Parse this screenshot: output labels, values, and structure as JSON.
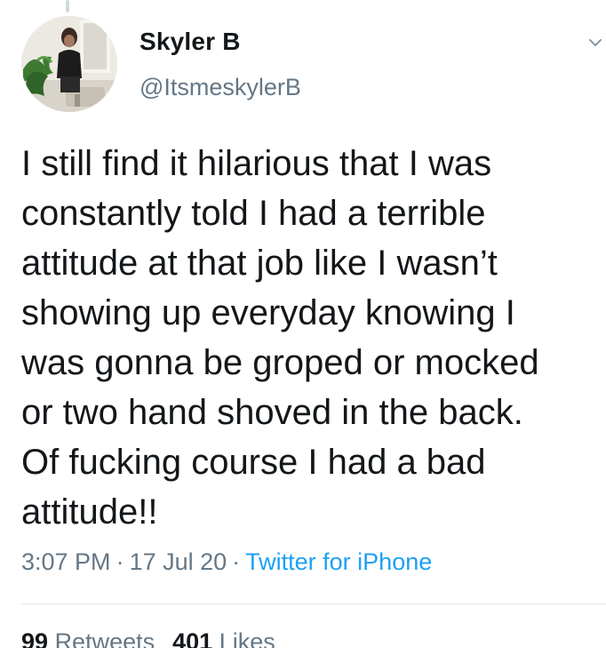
{
  "user": {
    "display_name": "Skyler B",
    "handle": "@ItsmeskylerB"
  },
  "tweet": {
    "text": "I still find it hilarious that I was\nconstantly told I had a terrible\nattitude at that job like I wasn’t\nshowing up everyday knowing I\nwas gonna be groped or mocked\nor two hand shoved in the back.\nOf fucking course I had a bad\nattitude!!",
    "time": "3:07 PM",
    "date": "17 Jul 20",
    "separator": "·",
    "source": "Twitter for iPhone"
  },
  "stats": {
    "retweets_count": "99",
    "retweets_label": "Retweets",
    "likes_count": "401",
    "likes_label": "Likes"
  },
  "icons": {
    "menu": "chevron-down-icon"
  },
  "colors": {
    "text": "#14171a",
    "secondary": "#657786",
    "link": "#1da1f2",
    "divider": "#e1e8ed"
  }
}
